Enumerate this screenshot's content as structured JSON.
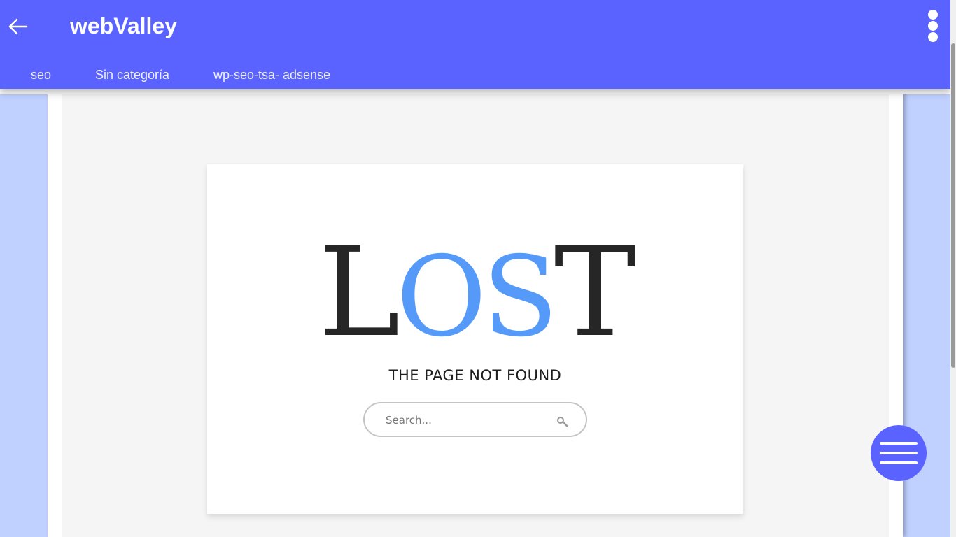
{
  "header": {
    "title": "webValley",
    "back_icon": "arrow-left-icon",
    "menu_icon": "more-vertical-icon"
  },
  "categories": [
    {
      "label": "seo"
    },
    {
      "label": "Sin categoría"
    },
    {
      "label": "wp-seo-tsa- adsense"
    }
  ],
  "error": {
    "lost_parts": [
      "L",
      "OS",
      "T"
    ],
    "subtitle": "THE PAGE NOT FOUND"
  },
  "search": {
    "placeholder": "Search...",
    "icon": "search-icon"
  },
  "fab": {
    "icon": "hamburger-menu-icon"
  },
  "colors": {
    "primary": "#5a63ff",
    "page_background": "#c0d1ff",
    "lost_dark": "#262626",
    "lost_accent": "#559af8"
  }
}
